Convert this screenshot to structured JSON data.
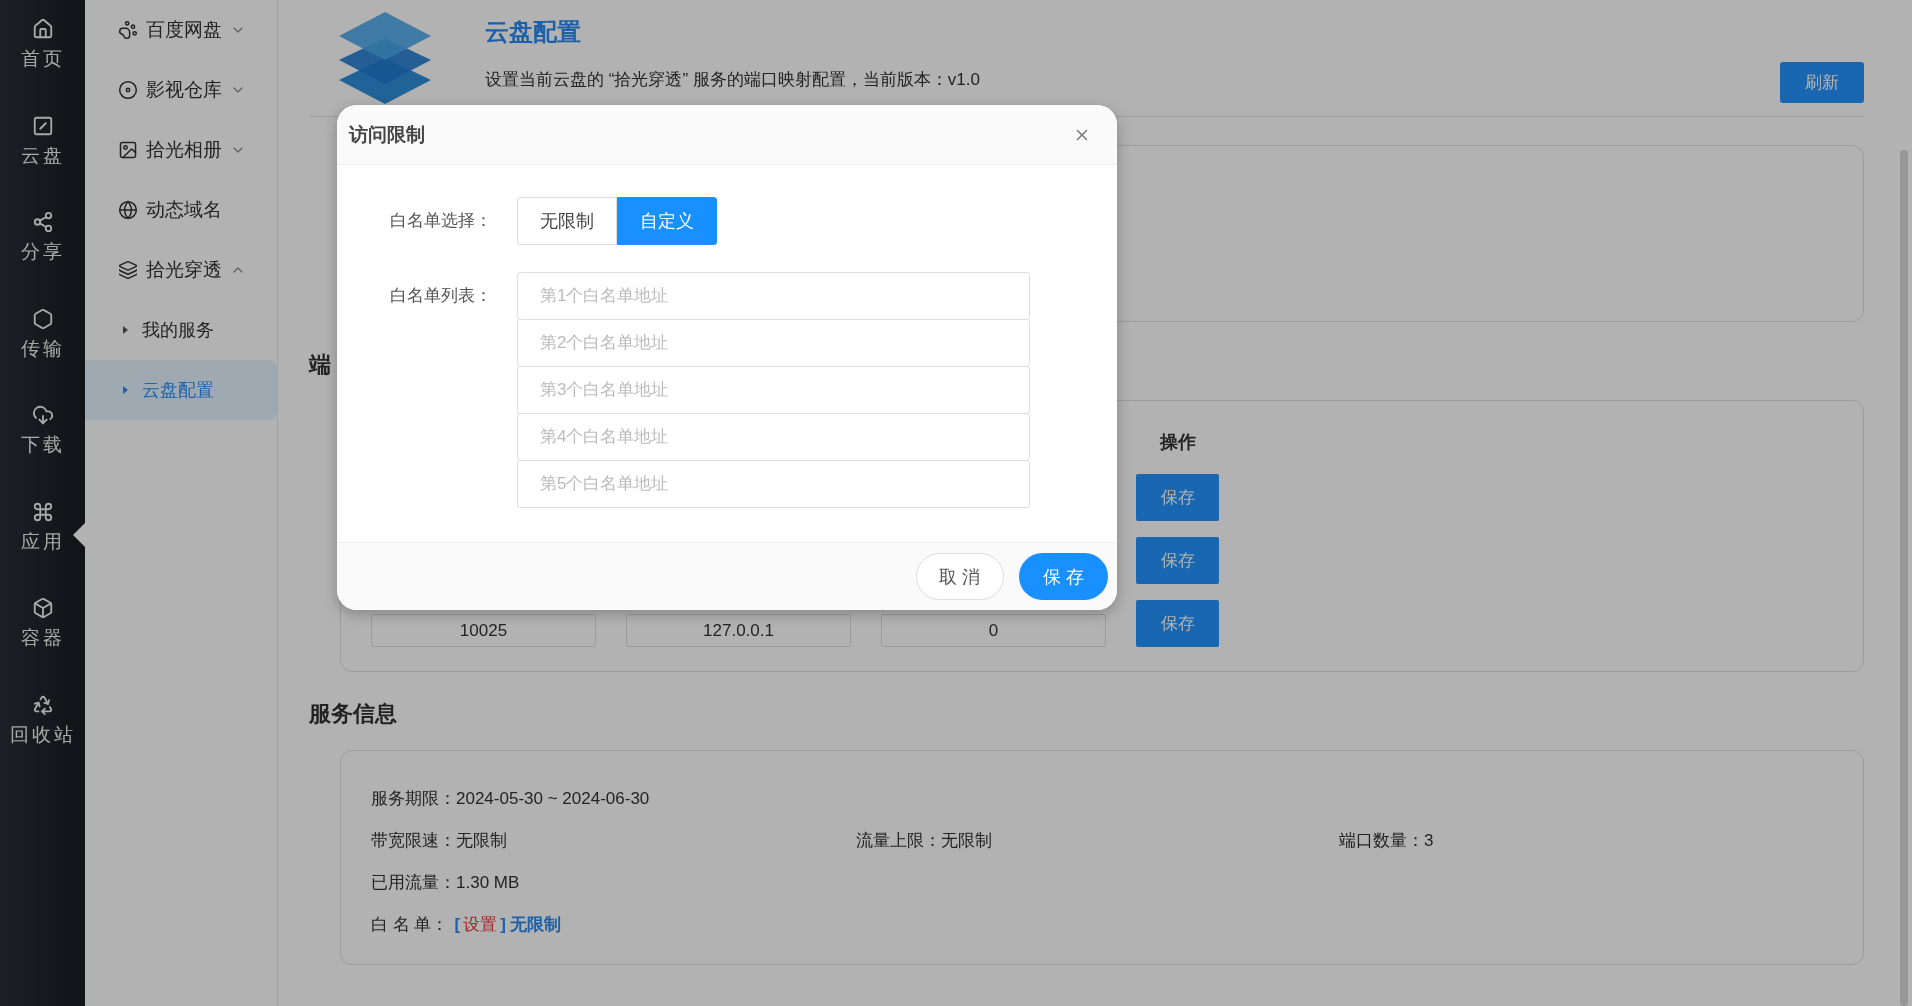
{
  "nav": [
    {
      "label": "首页",
      "selected": false
    },
    {
      "label": "云盘",
      "selected": false
    },
    {
      "label": "分享",
      "selected": false
    },
    {
      "label": "传输",
      "selected": false
    },
    {
      "label": "下载",
      "selected": false
    },
    {
      "label": "应用",
      "selected": true
    },
    {
      "label": "容器",
      "selected": false
    },
    {
      "label": "回收站",
      "selected": false
    }
  ],
  "menu": [
    {
      "label": "百度网盘",
      "kind": "group",
      "expanded": false
    },
    {
      "label": "影视仓库",
      "kind": "group",
      "expanded": false
    },
    {
      "label": "拾光相册",
      "kind": "group",
      "expanded": false
    },
    {
      "label": "动态域名",
      "kind": "link"
    },
    {
      "label": "拾光穿透",
      "kind": "group",
      "expanded": true,
      "children": [
        {
          "label": "我的服务",
          "selected": false
        },
        {
          "label": "云盘配置",
          "selected": true
        }
      ]
    }
  ],
  "header": {
    "title": "云盘配置",
    "description": "设置当前云盘的 “拾光穿透” 服务的端口映射配置，当前版本：v1.0",
    "refresh_button": "刷新"
  },
  "port_section": {
    "heading": "端",
    "columns": [
      "操作"
    ],
    "rows": [
      {
        "action": "保存"
      },
      {
        "action": "保存"
      },
      {
        "action": "保存",
        "cells": [
          "10025",
          "127.0.0.1",
          "0"
        ]
      }
    ]
  },
  "service_section": {
    "heading": "服务信息",
    "rows": [
      [
        {
          "label": "服务期限：",
          "value": "2024-05-30 ~ 2024-06-30"
        }
      ],
      [
        {
          "label": "带宽限速：",
          "value": "无限制"
        },
        {
          "label": "流量上限：",
          "value": "无限制"
        },
        {
          "label": "端口数量：",
          "value": "3"
        }
      ],
      [
        {
          "label": "已用流量：",
          "value": "1.30 MB"
        }
      ]
    ],
    "whitelist": {
      "label": "白 名 单：",
      "link_open": "[",
      "link": "设置",
      "link_close": "]",
      "value": "无限制"
    }
  },
  "dialog": {
    "title": "访问限制",
    "mode_label": "白名单选择：",
    "modes": [
      {
        "label": "无限制",
        "selected": false
      },
      {
        "label": "自定义",
        "selected": true
      }
    ],
    "list_label": "白名单列表：",
    "inputs": [
      {
        "placeholder": "第1个白名单地址"
      },
      {
        "placeholder": "第2个白名单地址"
      },
      {
        "placeholder": "第3个白名单地址"
      },
      {
        "placeholder": "第4个白名单地址"
      },
      {
        "placeholder": "第5个白名单地址"
      }
    ],
    "cancel_button": "取 消",
    "save_button": "保 存"
  }
}
